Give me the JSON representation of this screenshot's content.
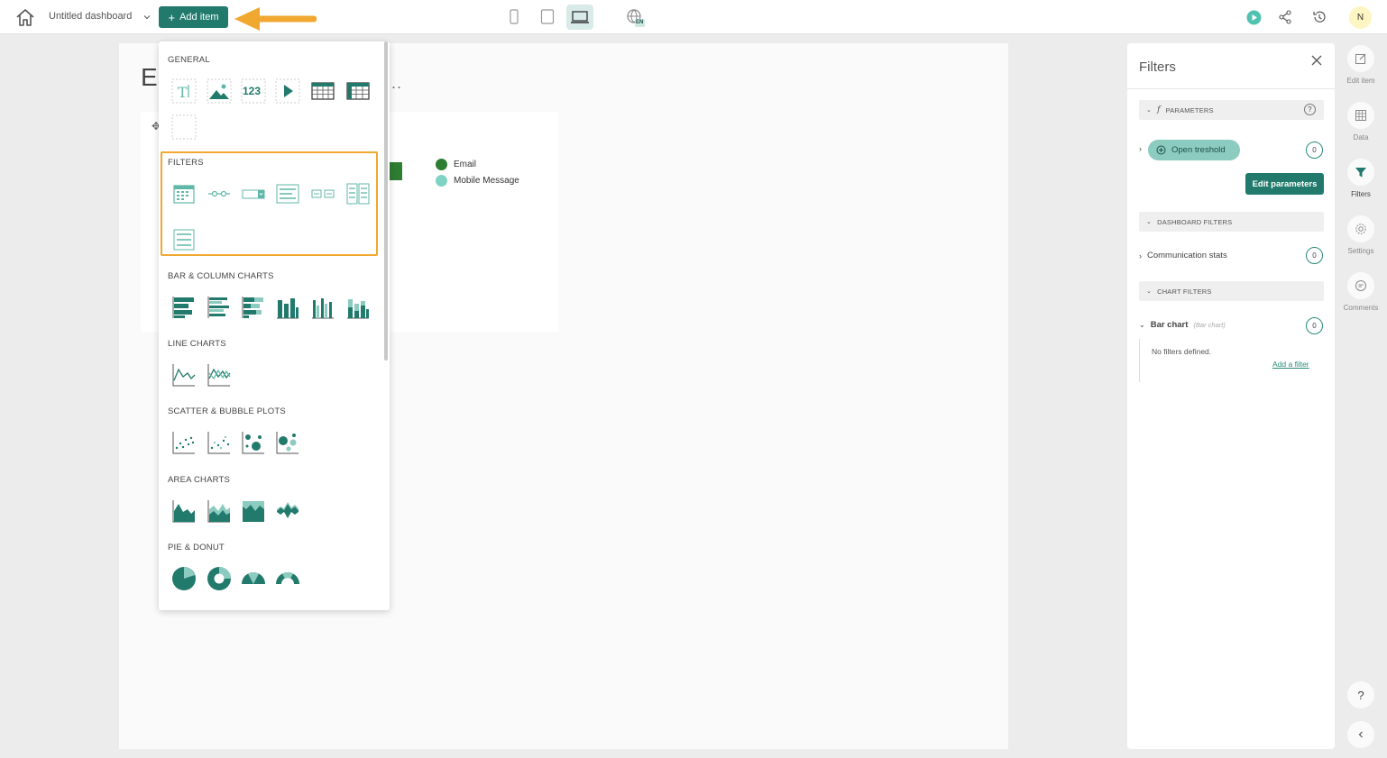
{
  "topbar": {
    "dashboard_title": "Untitled dashboard",
    "add_item_label": "Add item",
    "language_badge": "EN",
    "avatar_initial": "N"
  },
  "canvas": {
    "title_visible": "E",
    "title_overflow": "...",
    "legend": [
      {
        "label": "Email",
        "color": "#2e7d32"
      },
      {
        "label": "Mobile Message",
        "color": "#7fd3c4"
      }
    ]
  },
  "add_panel": {
    "sections": {
      "general": "GENERAL",
      "filters": "FILTERS",
      "bar_column": "BAR & COLUMN CHARTS",
      "line": "LINE CHARTS",
      "scatter": "SCATTER & BUBBLE PLOTS",
      "area": "AREA CHARTS",
      "pie": "PIE & DONUT"
    },
    "general_items": {
      "number": "123"
    }
  },
  "filters_panel": {
    "title": "Filters",
    "parameters_label": "PARAMETERS",
    "parameter_chip": "Open treshold",
    "parameter_count": "0",
    "edit_parameters_label": "Edit parameters",
    "dashboard_filters_label": "DASHBOARD FILTERS",
    "dashboard_filter_item": "Communication stats",
    "dashboard_filter_count": "0",
    "chart_filters_label": "CHART FILTERS",
    "chart_filter_item": "Bar chart",
    "chart_filter_type": "(Bar chart)",
    "chart_filter_count": "0",
    "no_filters_text": "No filters defined.",
    "add_filter_label": "Add a filter"
  },
  "rail": {
    "edit_item": "Edit item",
    "data": "Data",
    "filters": "Filters",
    "settings": "Settings",
    "comments": "Comments",
    "help": "?"
  },
  "colors": {
    "accent": "#217a6c",
    "accent_light": "#8ccbc0",
    "highlight": "#f0a830"
  }
}
